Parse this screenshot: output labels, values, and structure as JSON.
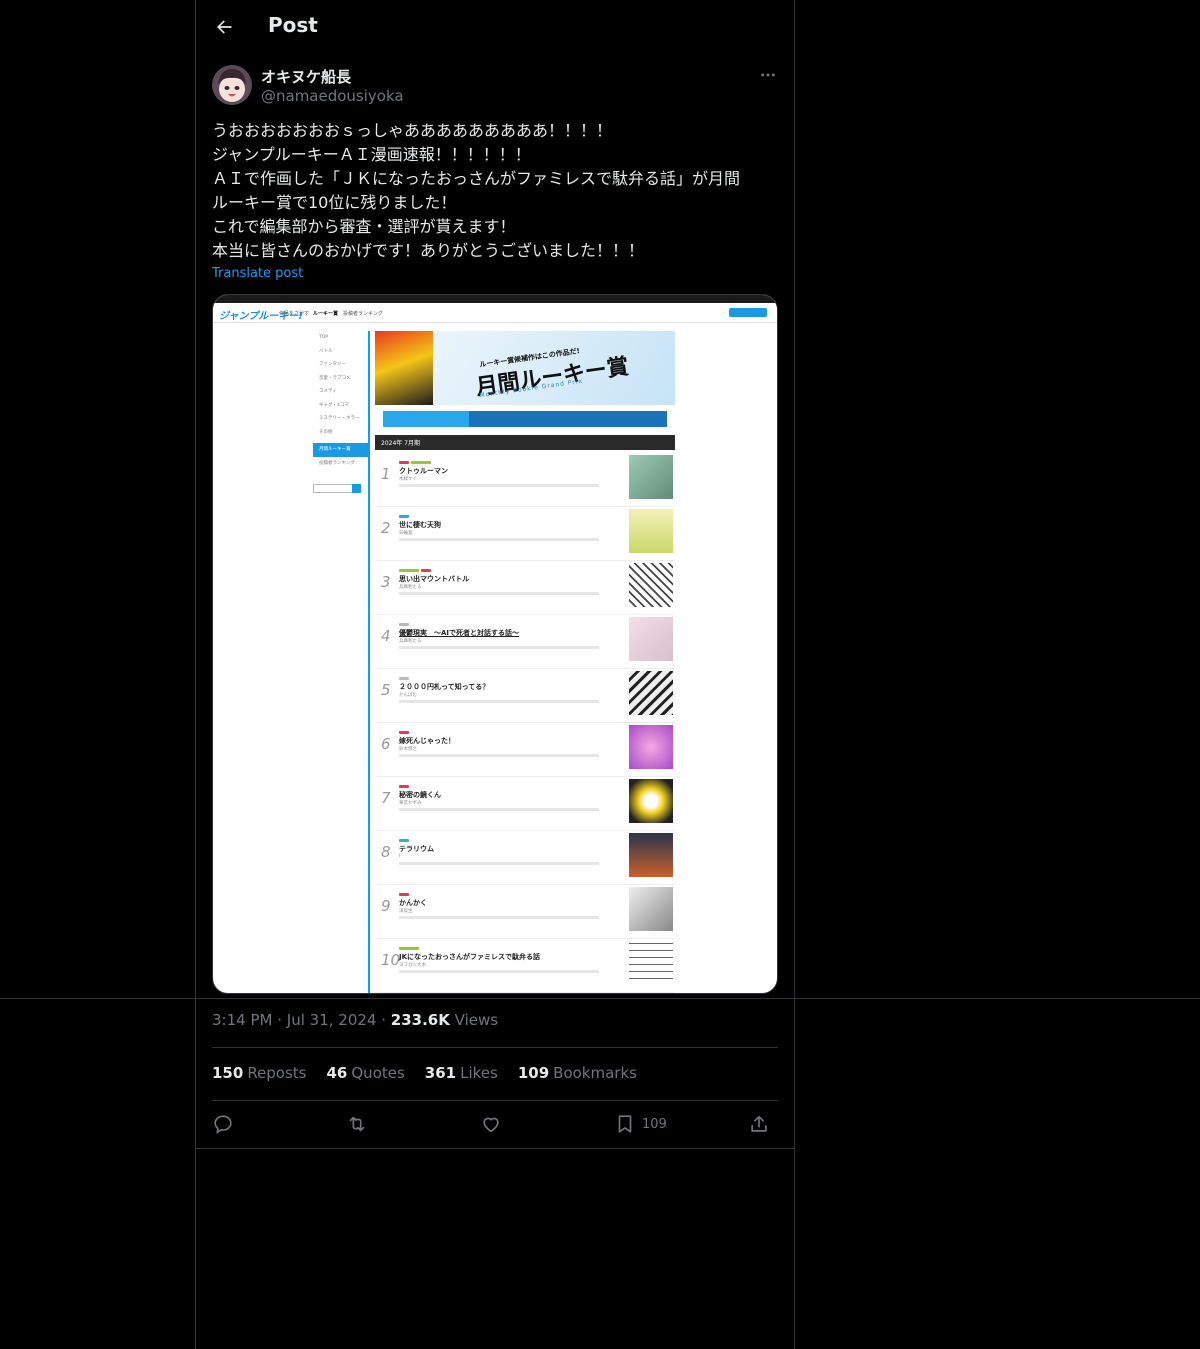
{
  "header": {
    "title": "Post"
  },
  "author": {
    "display_name": "オキヌケ船長",
    "handle": "@namaedousiyoka"
  },
  "tweet": {
    "lines": [
      "うおおおおおおおｓっしゃあああああああああ！！！！",
      "ジャンプルーキーＡＩ漫画速報！！！！！！",
      "ＡＩで作画した「ＪＫになったおっさんがファミレスで駄弁る話」が月間",
      "ルーキー賞で10位に残りました！",
      "これで編集部から審査・選評が貰えます！",
      "本当に皆さんのおかげです！ありがとうございました！！！"
    ],
    "translate_label": "Translate post"
  },
  "embedded_screenshot": {
    "logo": "ジャンプルーキー!",
    "nav": [
      "作品をさがす",
      "ルーキー賞",
      "投稿者ランキング"
    ],
    "sidebar": [
      "TOP",
      "バトル",
      "ファンタジー",
      "恋愛・ラブコメ",
      "コメディ",
      "ギャグ・4コマ",
      "ミステリー・ホラー",
      "その他",
      "月間ルーキー賞",
      "投稿者ランキング"
    ],
    "banner": {
      "subtitle": "ルーキー賞候補作はこの作品だ!",
      "title": "月間ルーキー賞",
      "english": "Monthly Rookie Grand Prix"
    },
    "month_label": "2024年 7月期",
    "rankings": [
      {
        "rank": "1",
        "title": "クトゥルーマン",
        "author": "木緑ケイ"
      },
      {
        "rank": "2",
        "title": "世に棲む天狗",
        "author": "日輪宴"
      },
      {
        "rank": "3",
        "title": "思い出マウントバトル",
        "author": "兵庫利たる"
      },
      {
        "rank": "4",
        "title": "優鬱現実　～AIで死者と対話する話～",
        "author": "兵庫利たる"
      },
      {
        "rank": "5",
        "title": "２０００円札って知ってる？",
        "author": "かんぱむ"
      },
      {
        "rank": "6",
        "title": "嫁死んじゃった！",
        "author": "鈴木悠之"
      },
      {
        "rank": "7",
        "title": "秘密の鏡くん",
        "author": "華宮かずみ"
      },
      {
        "rank": "8",
        "title": "テラリウム",
        "author": "I"
      },
      {
        "rank": "9",
        "title": "かんかく",
        "author": "洋貝生"
      },
      {
        "rank": "10",
        "title": "JKになったおっさんがファミレスで駄弁る話",
        "author": "ヨフカシ大木"
      }
    ]
  },
  "meta": {
    "time": "3:14 PM",
    "date": "Jul 31, 2024",
    "views_count": "233.6K",
    "views_label": "Views"
  },
  "stats": {
    "reposts_count": "150",
    "reposts_label": "Reposts",
    "quotes_count": "46",
    "quotes_label": "Quotes",
    "likes_count": "361",
    "likes_label": "Likes",
    "bookmarks_count": "109",
    "bookmarks_label": "Bookmarks"
  },
  "actions": {
    "bookmark_count": "109"
  },
  "icons": [
    "back-arrow-icon",
    "more-icon",
    "reply-icon",
    "repost-icon",
    "like-icon",
    "bookmark-icon",
    "share-icon"
  ],
  "colors": {
    "background": "#000000",
    "text": "#e7e9ea",
    "secondary": "#71767b",
    "accent": "#1d9bf0",
    "border": "#2f3336"
  }
}
